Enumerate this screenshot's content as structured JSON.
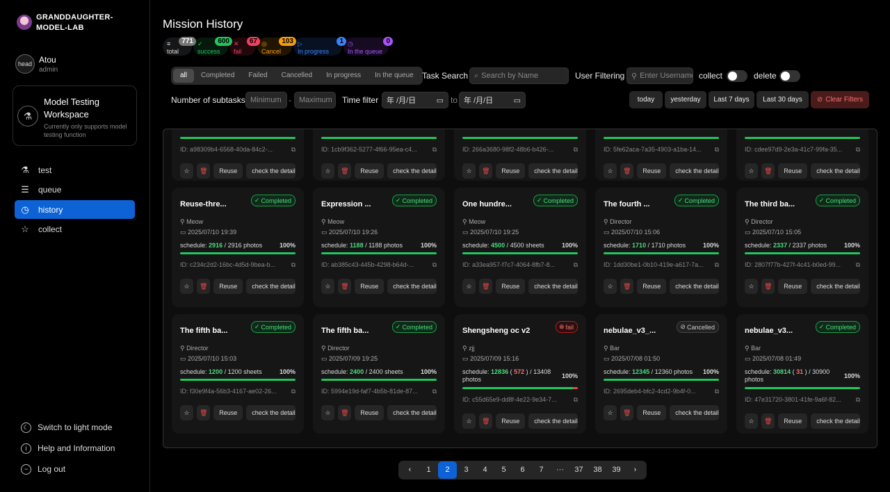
{
  "brand": {
    "name": "GRANDDAUGHTER-MODEL-LAB"
  },
  "user": {
    "avatar_text": "head",
    "name": "Atou",
    "role": "admin"
  },
  "workspace": {
    "title": "Model Testing Workspace",
    "desc": "Currently only supports model testing function"
  },
  "nav": [
    {
      "label": "test",
      "icon": "flask-icon"
    },
    {
      "label": "queue",
      "icon": "list-icon"
    },
    {
      "label": "history",
      "icon": "clock-icon",
      "active": true
    },
    {
      "label": "collect",
      "icon": "star-icon"
    }
  ],
  "bottom_nav": [
    {
      "label": "Switch to light mode",
      "icon": "moon-icon"
    },
    {
      "label": "Help and Information",
      "icon": "info-icon"
    },
    {
      "label": "Log out",
      "icon": "logout-icon"
    }
  ],
  "page_title": "Mission History",
  "stats": [
    {
      "label": "total",
      "count": "771",
      "color": "#9ca3af",
      "icon": "≡"
    },
    {
      "label": "success",
      "count": "600",
      "color": "#22c55e",
      "icon": "✓"
    },
    {
      "label": "fail",
      "count": "67",
      "color": "#f43f5e",
      "icon": "✕"
    },
    {
      "label": "Cancel",
      "count": "103",
      "color": "#f59e0b",
      "icon": "◎"
    },
    {
      "label": "In progress",
      "count": "1",
      "color": "#3b82f6",
      "icon": "▷"
    },
    {
      "label": "In the queue",
      "count": "0",
      "color": "#a855f7",
      "icon": "◷"
    }
  ],
  "tabs": [
    "all",
    "Completed",
    "Failed",
    "Cancelled",
    "In progress",
    "In the queue"
  ],
  "filters": {
    "task_search_label": "Task Search",
    "task_search_placeholder": "Search by Name",
    "user_filter_label": "User Filtering",
    "user_filter_placeholder": "Enter Username",
    "collect_label": "collect",
    "delete_label": "delete",
    "subtasks_label": "Number of subtasks",
    "min_placeholder": "Minimum",
    "max_placeholder": "Maximum",
    "dash": "-",
    "time_label": "Time filter",
    "date_placeholder": "年 /月/日",
    "to_label": "to",
    "quick": [
      "today",
      "yesterday",
      "Last 7 days",
      "Last 30 days"
    ],
    "clear_label": "Clear Filters"
  },
  "cards_top": [
    {
      "id": "ID: a98309b4-6568-40da-84c2-..."
    },
    {
      "id": "ID: 1cb9f362-5277-4f66-95ea-c4..."
    },
    {
      "id": "ID: 266a3680-98f2-48b6-b426-..."
    },
    {
      "id": "ID: 5fe62aca-7a35-4903-a1ba-14..."
    },
    {
      "id": "ID: cdee97d9-2e3a-41c7-99fa-35..."
    }
  ],
  "cards": [
    {
      "title": "Reuse-thre...",
      "status": "Completed",
      "user": "Meow",
      "date": "2025/07/10 19:39",
      "done": "2916",
      "total": "/ 2916 photos",
      "pct": "100%",
      "id": "ID: c234c2d2-16bc-4d5d-9bea-b..."
    },
    {
      "title": "Expression ...",
      "status": "Completed",
      "user": "Meow",
      "date": "2025/07/10 19:26",
      "done": "1188",
      "total": "/ 1188 photos",
      "pct": "100%",
      "id": "ID: ab385c43-445b-4298-b64d-..."
    },
    {
      "title": "One hundre...",
      "status": "Completed",
      "user": "Meow",
      "date": "2025/07/10 19:25",
      "done": "4500",
      "total": "/ 4500 sheets",
      "pct": "100%",
      "id": "ID: a33ea957-f7c7-4064-8fb7-8..."
    },
    {
      "title": "The fourth ...",
      "status": "Completed",
      "user": "Director",
      "date": "2025/07/10 15:06",
      "done": "1710",
      "total": "/ 1710 photos",
      "pct": "100%",
      "id": "ID: 1dd30be1-0b10-419e-a617-7a..."
    },
    {
      "title": "The third ba...",
      "status": "Completed",
      "user": "Director",
      "date": "2025/07/10 15:05",
      "done": "2337",
      "total": "/ 2337 photos",
      "pct": "100%",
      "id": "ID: 2807f77b-427f-4c41-b0ed-99..."
    },
    {
      "title": "The fifth ba...",
      "status": "Completed",
      "user": "Director",
      "date": "2025/07/10 15:03",
      "done": "1200",
      "total": "/ 1200 sheets",
      "pct": "100%",
      "id": "ID: f30e9f4a-56b3-4167-ae02-26..."
    },
    {
      "title": "The fifth ba...",
      "status": "Completed",
      "user": "Director",
      "date": "2025/07/09 19:25",
      "done": "2400",
      "total": "/ 2400 sheets",
      "pct": "100%",
      "id": "ID: 5994e19d-faf7-4b5b-81de-87..."
    },
    {
      "title": "Shengsheng oc v2",
      "status": "fail",
      "user": "zjj",
      "date": "2025/07/09 15:16",
      "done": "12836",
      "failed": "572",
      "total": "/ 13408 photos",
      "pct": "100%",
      "id": "ID: c55d65e9-dd8f-4e22-9e34-7..."
    },
    {
      "title": "nebulae_v3_...",
      "status": "Cancelled",
      "user": "Bar",
      "date": "2025/07/08 01:50",
      "done": "12345",
      "total": "/ 12360 photos",
      "pct": "100%",
      "id": "ID: 2695deb4-bfc2-4cd2-9b4f-0..."
    },
    {
      "title": "nebulae_v3...",
      "status": "Completed",
      "user": "Bar",
      "date": "2025/07/08 01:49",
      "done": "30814",
      "failed": "31",
      "total": "/ 30900 photos",
      "pct": "100%",
      "id": "ID: 47e31720-3801-41fe-9a6f-82..."
    }
  ],
  "card_labels": {
    "schedule": "schedule:",
    "reuse": "Reuse",
    "detail": "check the details"
  },
  "pagination": {
    "prev": "‹",
    "next": "›",
    "pages": [
      "1",
      "2",
      "3",
      "4",
      "5",
      "6",
      "7",
      "···",
      "37",
      "38",
      "39"
    ],
    "current": "2"
  }
}
